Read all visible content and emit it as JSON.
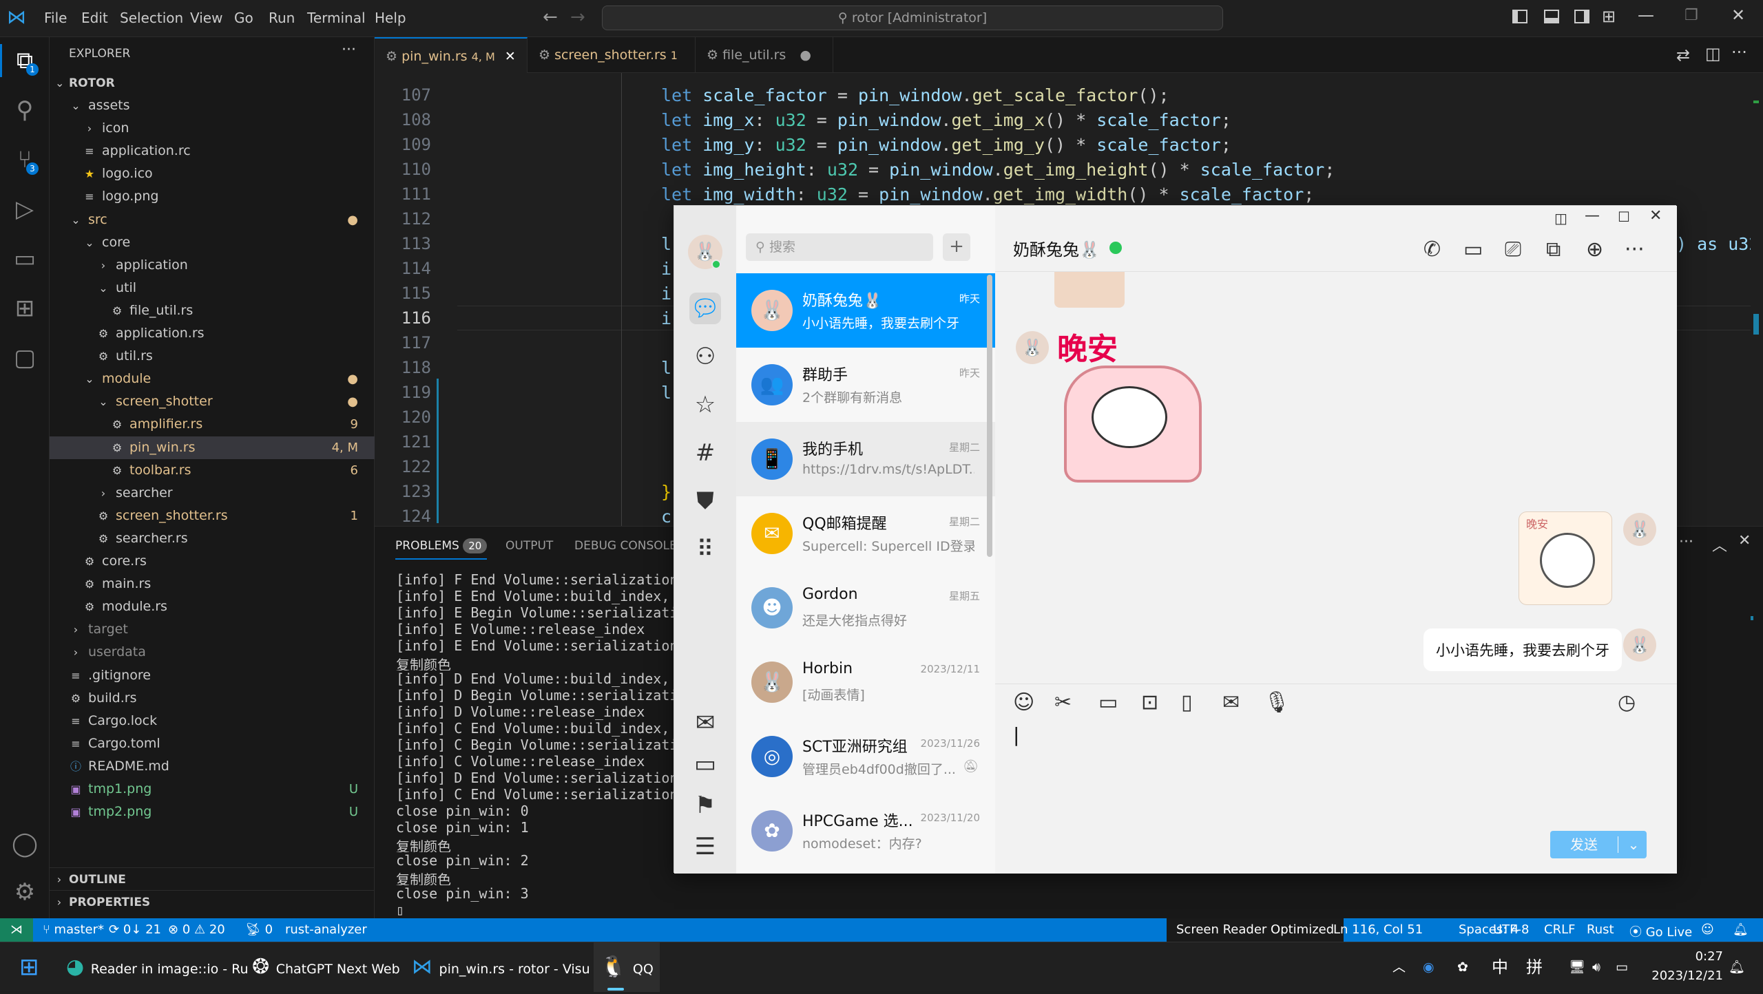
{
  "titlebar": {
    "menu": [
      "File",
      "Edit",
      "Selection",
      "View",
      "Go",
      "Run",
      "Terminal",
      "Help"
    ],
    "search": "rotor [Administrator]"
  },
  "activity": {
    "explorer_badge": "1",
    "scm_badge": "3"
  },
  "explorer": {
    "header": "EXPLORER",
    "root": "ROTOR",
    "items": [
      {
        "label": "assets",
        "indent": 1,
        "type": "folder-open",
        "dec": "",
        "color": "#cccccc",
        "sel": false
      },
      {
        "label": "icon",
        "indent": 2,
        "type": "folder",
        "dec": "",
        "color": "#cccccc",
        "sel": false
      },
      {
        "label": "application.rc",
        "indent": 2,
        "type": "file",
        "dec": "",
        "color": "#cccccc",
        "sel": false
      },
      {
        "label": "logo.ico",
        "indent": 2,
        "type": "star",
        "dec": "",
        "color": "#cccccc",
        "sel": false
      },
      {
        "label": "logo.png",
        "indent": 2,
        "type": "file",
        "dec": "",
        "color": "#cccccc",
        "sel": false
      },
      {
        "label": "src",
        "indent": 1,
        "type": "folder-open",
        "dec": "●",
        "color": "#e2c08d",
        "sel": false
      },
      {
        "label": "core",
        "indent": 2,
        "type": "folder-open",
        "dec": "",
        "color": "#cccccc",
        "sel": false
      },
      {
        "label": "application",
        "indent": 3,
        "type": "folder",
        "dec": "",
        "color": "#cccccc",
        "sel": false
      },
      {
        "label": "util",
        "indent": 3,
        "type": "folder-open",
        "dec": "",
        "color": "#cccccc",
        "sel": false
      },
      {
        "label": "file_util.rs",
        "indent": 4,
        "type": "rs",
        "dec": "",
        "color": "#cccccc",
        "sel": false
      },
      {
        "label": "application.rs",
        "indent": 3,
        "type": "rs",
        "dec": "",
        "color": "#cccccc",
        "sel": false
      },
      {
        "label": "util.rs",
        "indent": 3,
        "type": "rs",
        "dec": "",
        "color": "#cccccc",
        "sel": false
      },
      {
        "label": "module",
        "indent": 2,
        "type": "folder-open",
        "dec": "●",
        "color": "#e2c08d",
        "sel": false
      },
      {
        "label": "screen_shotter",
        "indent": 3,
        "type": "folder-open",
        "dec": "●",
        "color": "#e2c08d",
        "sel": false
      },
      {
        "label": "amplifier.rs",
        "indent": 4,
        "type": "rs",
        "dec": "9",
        "color": "#e2c08d",
        "sel": false
      },
      {
        "label": "pin_win.rs",
        "indent": 4,
        "type": "rs",
        "dec": "4, M",
        "color": "#e2c08d",
        "sel": true
      },
      {
        "label": "toolbar.rs",
        "indent": 4,
        "type": "rs",
        "dec": "6",
        "color": "#e2c08d",
        "sel": false
      },
      {
        "label": "searcher",
        "indent": 3,
        "type": "folder",
        "dec": "",
        "color": "#cccccc",
        "sel": false
      },
      {
        "label": "screen_shotter.rs",
        "indent": 3,
        "type": "rs",
        "dec": "1",
        "color": "#e2c08d",
        "sel": false
      },
      {
        "label": "searcher.rs",
        "indent": 3,
        "type": "rs",
        "dec": "",
        "color": "#cccccc",
        "sel": false
      },
      {
        "label": "core.rs",
        "indent": 2,
        "type": "rs",
        "dec": "",
        "color": "#cccccc",
        "sel": false
      },
      {
        "label": "main.rs",
        "indent": 2,
        "type": "rs",
        "dec": "",
        "color": "#cccccc",
        "sel": false
      },
      {
        "label": "module.rs",
        "indent": 2,
        "type": "rs",
        "dec": "",
        "color": "#cccccc",
        "sel": false
      },
      {
        "label": "target",
        "indent": 1,
        "type": "folder",
        "dec": "",
        "color": "#8c8c8c",
        "sel": false
      },
      {
        "label": "userdata",
        "indent": 1,
        "type": "folder",
        "dec": "",
        "color": "#8c8c8c",
        "sel": false
      },
      {
        "label": ".gitignore",
        "indent": 1,
        "type": "file",
        "dec": "",
        "color": "#cccccc",
        "sel": false
      },
      {
        "label": "build.rs",
        "indent": 1,
        "type": "rs",
        "dec": "",
        "color": "#cccccc",
        "sel": false
      },
      {
        "label": "Cargo.lock",
        "indent": 1,
        "type": "file",
        "dec": "",
        "color": "#cccccc",
        "sel": false
      },
      {
        "label": "Cargo.toml",
        "indent": 1,
        "type": "file",
        "dec": "",
        "color": "#cccccc",
        "sel": false
      },
      {
        "label": "README.md",
        "indent": 1,
        "type": "info",
        "dec": "",
        "color": "#cccccc",
        "sel": false
      },
      {
        "label": "tmp1.png",
        "indent": 1,
        "type": "img",
        "dec": "U",
        "color": "#73c991",
        "sel": false
      },
      {
        "label": "tmp2.png",
        "indent": 1,
        "type": "img",
        "dec": "U",
        "color": "#73c991",
        "sel": false
      }
    ],
    "outline": "OUTLINE",
    "properties": "PROPERTIES"
  },
  "tabs": [
    {
      "label": "pin_win.rs",
      "dec": "4, M",
      "close": "✕",
      "active": true
    },
    {
      "label": "screen_shotter.rs",
      "dec": "1",
      "close": "",
      "active": false
    },
    {
      "label": "file_util.rs",
      "dec": "",
      "close": "●",
      "active": false
    }
  ],
  "code": {
    "lines": [
      "107",
      "108",
      "109",
      "110",
      "111",
      "112",
      "113",
      "114",
      "115",
      "116",
      "117",
      "118",
      "119",
      "120",
      "121",
      "122",
      "123",
      "124"
    ],
    "l107": [
      "let ",
      "scale_factor",
      " = ",
      "pin_window",
      ".",
      "get_scale_factor",
      "();"
    ],
    "l108": [
      "let ",
      "img_x",
      ": ",
      "u32",
      " = ",
      "pin_window",
      ".",
      "get_img_x",
      "() * ",
      "scale_factor",
      ";"
    ],
    "l109": [
      "let ",
      "img_y",
      ": ",
      "u32",
      " = ",
      "pin_window",
      ".",
      "get_img_y",
      "() * ",
      "scale_factor",
      ";"
    ],
    "l110": [
      "let ",
      "img_height",
      ": ",
      "u32",
      " = ",
      "pin_window",
      ".",
      "get_img_height",
      "() * ",
      "scale_factor",
      ";"
    ],
    "l111": [
      "let ",
      "img_width",
      ": ",
      "u32",
      " = ",
      "pin_window",
      ".",
      "get_img_width",
      "() * ",
      "scale_factor",
      ";"
    ],
    "frag_right": ") as u32",
    "frag_l": "l",
    "frag_i": "i",
    "frag_brace": "}",
    "frag_c": "c"
  },
  "panel": {
    "tabs": [
      "PROBLEMS",
      "OUTPUT",
      "DEBUG CONSOLE"
    ],
    "problems_count": "20",
    "lines": [
      "[info] F End Volume::serialization_wr",
      "[info] E End Volume::build_index, use",
      "[info] E Begin Volume::serialization_",
      "[info] E Volume::release_index",
      "[info] E End Volume::serialization_wr",
      "复制颜色",
      "[info] D End Volume::build_index, use",
      "[info] D Begin Volume::serialization_",
      "[info] D Volume::release_index",
      "[info] C End Volume::build_index, use",
      "[info] C Begin Volume::serialization_",
      "[info] C Volume::release_index",
      "[info] D End Volume::serialization_wr",
      "[info] C End Volume::serialization_wr",
      "close pin_win: 0",
      "close pin_win: 1",
      "复制颜色",
      "close pin_win: 2",
      "复制颜色",
      "close pin_win: 3",
      "▯"
    ]
  },
  "status": {
    "branch": "master*",
    "sync": "0↓ 21",
    "errors": "0",
    "warnings": "20",
    "ports": "0",
    "lsp": "rust-analyzer",
    "screen_reader": "Screen Reader Optimized",
    "position": "Ln 116, Col 51",
    "spaces": "Spaces: 4",
    "encoding": "UTF-8",
    "eol": "CRLF",
    "lang": "Rust",
    "golive": "Go Live"
  },
  "taskbar": {
    "apps": [
      "Reader in image::io - Ru",
      "ChatGPT Next Web",
      "pin_win.rs - rotor - Visu",
      "QQ"
    ],
    "ime1": "中",
    "ime2": "拼",
    "time": "0:27",
    "date": "2023/12/21"
  },
  "qq": {
    "search_placeholder": "搜索",
    "add": "+",
    "chat_title": "奶酥兔兔🐰",
    "chats": [
      {
        "name": "奶酥兔兔🐰",
        "msg": "小小语先睡，我要去刷个牙",
        "time": "昨天",
        "avatar_color": "#f2c9b6",
        "glyph": "🐰",
        "active": true
      },
      {
        "name": "群助手",
        "msg": "2个群聊有新消息",
        "time": "昨天",
        "avatar_color": "#2d86e5",
        "glyph": "👥",
        "active": false
      },
      {
        "name": "我的手机",
        "msg": "https://1drv.ms/t/s!ApLDT...",
        "time": "星期二",
        "avatar_color": "#2d86e5",
        "glyph": "📱",
        "active": false
      },
      {
        "name": "QQ邮箱提醒",
        "msg": "Supercell: Supercell ID登录...",
        "time": "星期二",
        "avatar_color": "#f7b500",
        "glyph": "✉",
        "active": false
      },
      {
        "name": "Gordon",
        "msg": "还是大佬指点得好",
        "time": "星期五",
        "avatar_color": "#6fa6d8",
        "glyph": "☻",
        "active": false
      },
      {
        "name": "Horbin",
        "msg": "[动画表情]",
        "time": "2023/12/11",
        "avatar_color": "#c9a88c",
        "glyph": "🐰",
        "active": false
      },
      {
        "name": "SCT亚洲研究组",
        "msg": "管理员eb4df00d撤回了...",
        "time": "2023/11/26",
        "avatar_color": "#2a6fc9",
        "glyph": "◎",
        "active": false
      },
      {
        "name": "HPCGame 选...",
        "msg": "nomodeset：内存?",
        "time": "2023/11/20",
        "avatar_color": "#8c9fd1",
        "glyph": "✿",
        "active": false
      }
    ],
    "sticker_text": "晚安",
    "sticker2_text": "晚安",
    "my_message": "小小语先睡，我要去刷个牙",
    "send": "发送",
    "cursor": "|"
  }
}
